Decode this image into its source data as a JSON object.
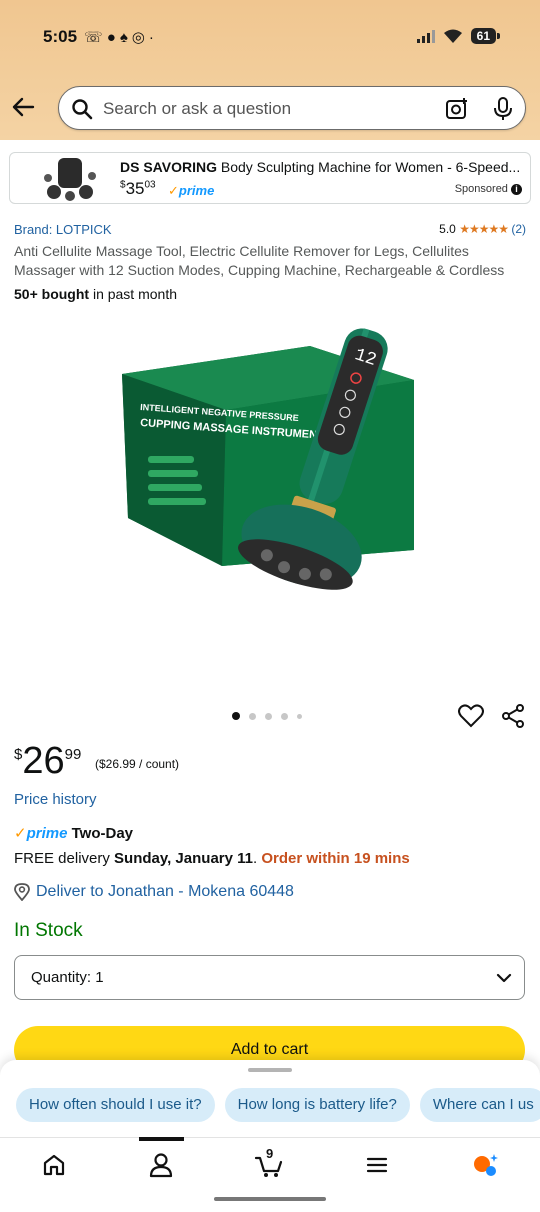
{
  "status_bar": {
    "time": "5:05",
    "battery": "61",
    "notification_icons": [
      "missed-call-icon",
      "chat-icon",
      "snapchat-icon",
      "at-icon",
      "dot-icon"
    ]
  },
  "search": {
    "placeholder": "Search or ask a question"
  },
  "sponsored_ad": {
    "brand": "DS SAVORING",
    "title": "Body Sculpting Machine for Women - 6-Speed...",
    "price_whole": "35",
    "price_fraction": "03",
    "currency": "$",
    "prime_label": "prime",
    "sponsored_label": "Sponsored"
  },
  "product": {
    "brand_link": "Brand: LOTPICK",
    "rating_value": "5.0",
    "rating_stars": "★★★★★",
    "rating_count": "(2)",
    "title": "Anti Cellulite Massage Tool, Electric Cellulite Remover for Legs, Cellulites Massager with 12 Suction Modes, Cupping Machine, Rechargeable & Cordless",
    "bought_bold": "50+ bought",
    "bought_rest": " in past month",
    "image_box_text_1": "INTELLIGENT NEGATIVE PRESSURE",
    "image_box_text_2": "CUPPING MASSAGE INSTRUMENT",
    "device_display": "12",
    "carousel_count": 5,
    "carousel_active": 0
  },
  "pricing": {
    "currency": "$",
    "whole": "26",
    "fraction": "99",
    "unit_price": "($26.99 / count)",
    "history_link": "Price history"
  },
  "delivery": {
    "prime_word": "prime",
    "two_day": "Two-Day",
    "free_delivery": "FREE delivery ",
    "date": "Sunday, January 11",
    "separator": ". ",
    "urgency": "Order within 19 mins",
    "location": "Deliver to Jonathan - Mokena 60448"
  },
  "stock": "In Stock",
  "quantity": {
    "label": "Quantity: 1"
  },
  "add_to_cart": "Add to cart",
  "suggestions": [
    "How often should I use it?",
    "How long is battery life?",
    "Where can I us"
  ],
  "bottom_nav": {
    "cart_count": "9",
    "items": [
      "home-icon",
      "account-icon",
      "cart-icon",
      "menu-icon",
      "rufus-icon"
    ]
  },
  "colors": {
    "header_bg": "#f0c690",
    "link": "#2162a1",
    "prime_blue": "#1399ff",
    "in_stock": "#007600",
    "urgency": "#c7511f",
    "add_to_cart": "#ffd814",
    "chip_bg": "#d7ecf9"
  }
}
